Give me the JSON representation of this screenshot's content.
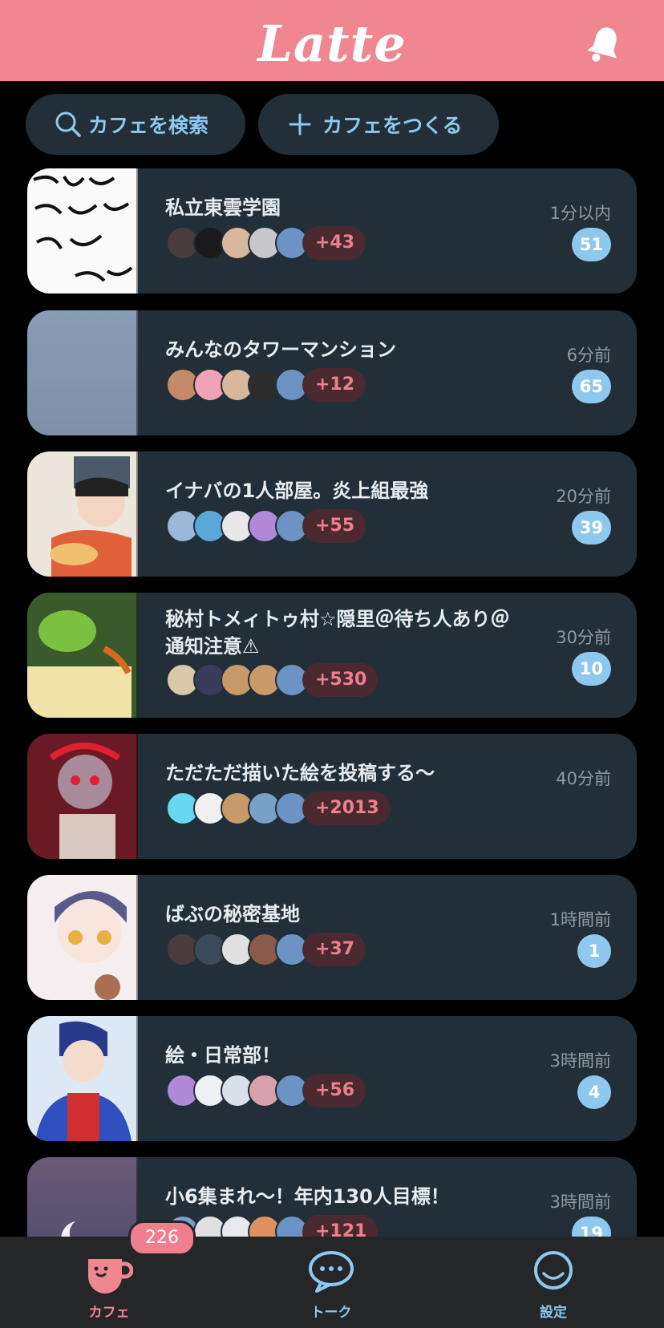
{
  "header": {
    "logo": "Latte"
  },
  "actions": {
    "search_label": "カフェを検索",
    "create_label": "カフェをつくる"
  },
  "cafes": [
    {
      "title": "私立東雲学園",
      "extra_members": "+43",
      "time": "1分以内",
      "unread": "51"
    },
    {
      "title": "みんなのタワーマンション",
      "extra_members": "+12",
      "time": "6分前",
      "unread": "65"
    },
    {
      "title": "イナバの1人部屋。炎上組最強",
      "extra_members": "+55",
      "time": "20分前",
      "unread": "39"
    },
    {
      "title": "秘村トメィトゥ村☆隠里＠待ち人あり＠通知注意⚠",
      "extra_members": "+530",
      "time": "30分前",
      "unread": "10"
    },
    {
      "title": "ただただ描いた絵を投稿する〜",
      "extra_members": "+2013",
      "time": "40分前",
      "unread": ""
    },
    {
      "title": "ばぶの秘密基地",
      "extra_members": "+37",
      "time": "1時間前",
      "unread": "1"
    },
    {
      "title": "絵・日常部！",
      "extra_members": "+56",
      "time": "3時間前",
      "unread": "4"
    },
    {
      "title": "小6集まれ〜！年内130人目標！",
      "extra_members": "+121",
      "time": "3時間前",
      "unread": "19"
    }
  ],
  "tabbar": {
    "cafe_label": "カフェ",
    "cafe_badge": "226",
    "talk_label": "トーク",
    "settings_label": "設定"
  },
  "colors": {
    "brand": "#f0868f",
    "accent": "#8fc8ee",
    "card": "#222f38",
    "background": "#000000"
  }
}
